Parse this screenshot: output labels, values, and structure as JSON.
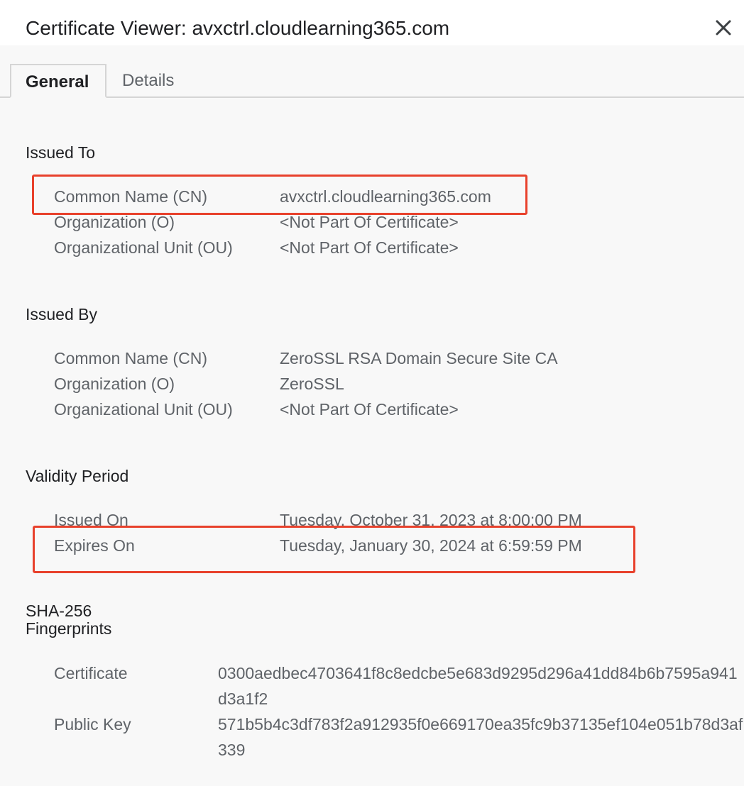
{
  "window": {
    "title": "Certificate Viewer: avxctrl.cloudlearning365.com",
    "close_icon": "close-icon"
  },
  "tabs": [
    {
      "label": "General",
      "selected": true
    },
    {
      "label": "Details",
      "selected": false
    }
  ],
  "issued_to": {
    "heading": "Issued To",
    "rows": [
      {
        "label": "Common Name (CN)",
        "value": "avxctrl.cloudlearning365.com"
      },
      {
        "label": "Organization (O)",
        "value": "<Not Part Of Certificate>"
      },
      {
        "label": "Organizational Unit (OU)",
        "value": "<Not Part Of Certificate>"
      }
    ]
  },
  "issued_by": {
    "heading": "Issued By",
    "rows": [
      {
        "label": "Common Name (CN)",
        "value": "ZeroSSL RSA Domain Secure Site CA"
      },
      {
        "label": "Organization (O)",
        "value": "ZeroSSL"
      },
      {
        "label": "Organizational Unit (OU)",
        "value": "<Not Part Of Certificate>"
      }
    ]
  },
  "validity": {
    "heading": "Validity Period",
    "rows": [
      {
        "label": "Issued On",
        "value": "Tuesday, October 31, 2023 at 8:00:00 PM"
      },
      {
        "label": "Expires On",
        "value": "Tuesday, January 30, 2024 at 6:59:59 PM"
      }
    ]
  },
  "fingerprints": {
    "heading_line1": "SHA-256",
    "heading_line2": "Fingerprints",
    "rows": [
      {
        "label": "Certificate",
        "value": "0300aedbec4703641f8c8edcbe5e683d9295d296a41dd84b6b7595a941d3a1f2"
      },
      {
        "label": "Public Key",
        "value": "571b5b4c3df783f2a912935f0e669170ea35fc9b37135ef104e051b78d3af339"
      }
    ]
  },
  "colors": {
    "highlight": "#e8412c",
    "background": "#f8f8f8",
    "title_bar": "#ffffff"
  }
}
